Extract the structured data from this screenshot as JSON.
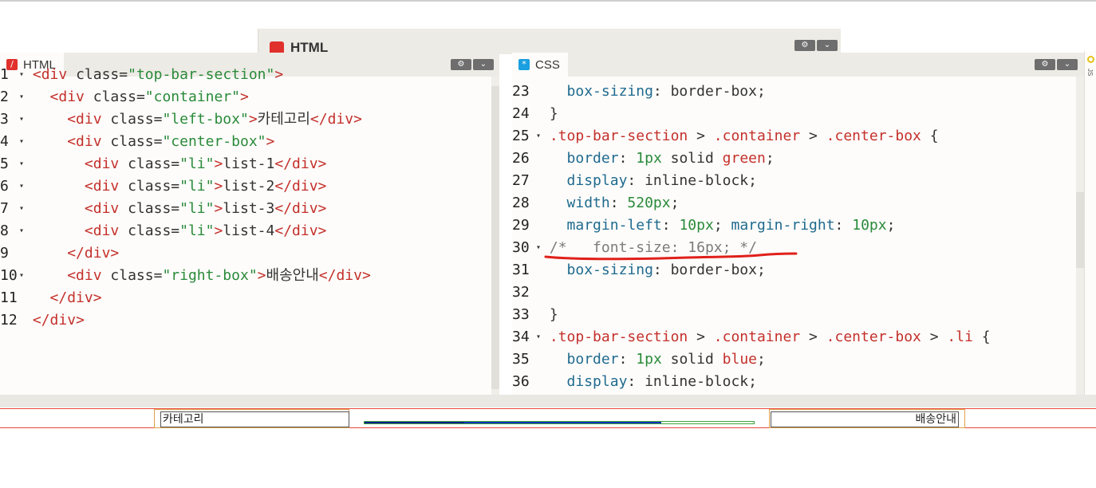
{
  "back_panel": {
    "tab_label": "HTML"
  },
  "html_panel": {
    "tab_label": "HTML",
    "lines": [
      {
        "n": "1",
        "fold": true,
        "text": "<div class=\"top-bar-section\">"
      },
      {
        "n": "2",
        "fold": true,
        "text": "  <div class=\"container\">"
      },
      {
        "n": "3",
        "fold": true,
        "text": "    <div class=\"left-box\">카테고리</div>"
      },
      {
        "n": "4",
        "fold": true,
        "text": "    <div class=\"center-box\">"
      },
      {
        "n": "5",
        "fold": true,
        "text": "      <div class=\"li\">list-1</div>"
      },
      {
        "n": "6",
        "fold": true,
        "text": "      <div class=\"li\">list-2</div>"
      },
      {
        "n": "7",
        "fold": true,
        "text": "      <div class=\"li\">list-3</div>"
      },
      {
        "n": "8",
        "fold": true,
        "text": "      <div class=\"li\">list-4</div>"
      },
      {
        "n": "9",
        "fold": false,
        "text": "    </div>"
      },
      {
        "n": "10",
        "fold": true,
        "text": "    <div class=\"right-box\">배송안내</div>"
      },
      {
        "n": "11",
        "fold": false,
        "text": "  </div>"
      },
      {
        "n": "12",
        "fold": false,
        "text": "</div>"
      }
    ]
  },
  "css_panel": {
    "tab_label": "CSS",
    "lines": [
      {
        "n": "23",
        "fold": false,
        "text": "  box-sizing: border-box;"
      },
      {
        "n": "24",
        "fold": false,
        "text": "}"
      },
      {
        "n": "25",
        "fold": true,
        "text": ".top-bar-section > .container > .center-box {"
      },
      {
        "n": "26",
        "fold": false,
        "text": "  border: 1px solid green;"
      },
      {
        "n": "27",
        "fold": false,
        "text": "  display: inline-block;"
      },
      {
        "n": "28",
        "fold": false,
        "text": "  width: 520px;"
      },
      {
        "n": "29",
        "fold": false,
        "text": "  margin-left: 10px; margin-right: 10px;"
      },
      {
        "n": "30",
        "fold": true,
        "text": "/*   font-size: 16px; */"
      },
      {
        "n": "31",
        "fold": false,
        "text": "  box-sizing: border-box;"
      },
      {
        "n": "32",
        "fold": false,
        "text": ""
      },
      {
        "n": "33",
        "fold": false,
        "text": "}"
      },
      {
        "n": "34",
        "fold": true,
        "text": ".top-bar-section > .container > .center-box > .li {"
      },
      {
        "n": "35",
        "fold": false,
        "text": "  border: 1px solid blue;"
      },
      {
        "n": "36",
        "fold": false,
        "text": "  display: inline-block;"
      }
    ]
  },
  "output": {
    "left_box": "카테고리",
    "right_box": "배송안내"
  },
  "side_strip": {
    "label": "JS"
  },
  "colors": {
    "annotation": "#e0201a",
    "html_icon": "#e0312d",
    "css_icon": "#1a9fe0"
  }
}
